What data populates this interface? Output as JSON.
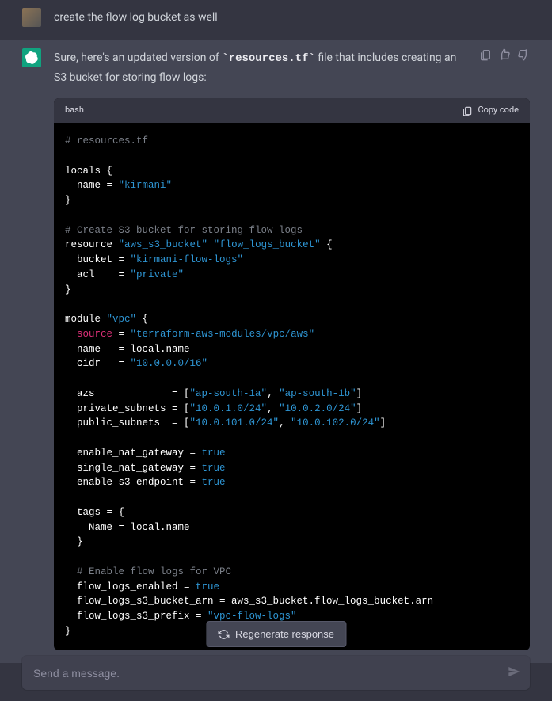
{
  "messages": {
    "user": {
      "text": "create the flow log bucket as well"
    },
    "assistant": {
      "intro_before": "Sure, here's an updated version of ",
      "intro_code": "`resources.tf`",
      "intro_after": " file that includes creating an S3 bucket for storing flow logs:"
    }
  },
  "code": {
    "lang": "bash",
    "copy_label": "Copy code",
    "lines": [
      [
        {
          "t": "comment",
          "v": "# resources.tf"
        }
      ],
      [],
      [
        {
          "t": "default",
          "v": "locals {"
        }
      ],
      [
        {
          "t": "default",
          "v": "  name = "
        },
        {
          "t": "string",
          "v": "\"kirmani\""
        }
      ],
      [
        {
          "t": "default",
          "v": "}"
        }
      ],
      [],
      [
        {
          "t": "comment",
          "v": "# Create S3 bucket for storing flow logs"
        }
      ],
      [
        {
          "t": "default",
          "v": "resource "
        },
        {
          "t": "string",
          "v": "\"aws_s3_bucket\""
        },
        {
          "t": "default",
          "v": " "
        },
        {
          "t": "string",
          "v": "\"flow_logs_bucket\""
        },
        {
          "t": "default",
          "v": " {"
        }
      ],
      [
        {
          "t": "default",
          "v": "  bucket = "
        },
        {
          "t": "string",
          "v": "\"kirmani-flow-logs\""
        }
      ],
      [
        {
          "t": "default",
          "v": "  acl    = "
        },
        {
          "t": "string",
          "v": "\"private\""
        }
      ],
      [
        {
          "t": "default",
          "v": "}"
        }
      ],
      [],
      [
        {
          "t": "default",
          "v": "module "
        },
        {
          "t": "string",
          "v": "\"vpc\""
        },
        {
          "t": "default",
          "v": " {"
        }
      ],
      [
        {
          "t": "default",
          "v": "  "
        },
        {
          "t": "builtin",
          "v": "source"
        },
        {
          "t": "default",
          "v": " = "
        },
        {
          "t": "string",
          "v": "\"terraform-aws-modules/vpc/aws\""
        }
      ],
      [
        {
          "t": "default",
          "v": "  name   = local.name"
        }
      ],
      [
        {
          "t": "default",
          "v": "  cidr   = "
        },
        {
          "t": "string",
          "v": "\"10.0.0.0/16\""
        }
      ],
      [],
      [
        {
          "t": "default",
          "v": "  azs             = ["
        },
        {
          "t": "string",
          "v": "\"ap-south-1a\""
        },
        {
          "t": "default",
          "v": ", "
        },
        {
          "t": "string",
          "v": "\"ap-south-1b\""
        },
        {
          "t": "default",
          "v": "]"
        }
      ],
      [
        {
          "t": "default",
          "v": "  private_subnets = ["
        },
        {
          "t": "string",
          "v": "\"10.0.1.0/24\""
        },
        {
          "t": "default",
          "v": ", "
        },
        {
          "t": "string",
          "v": "\"10.0.2.0/24\""
        },
        {
          "t": "default",
          "v": "]"
        }
      ],
      [
        {
          "t": "default",
          "v": "  public_subnets  = ["
        },
        {
          "t": "string",
          "v": "\"10.0.101.0/24\""
        },
        {
          "t": "default",
          "v": ", "
        },
        {
          "t": "string",
          "v": "\"10.0.102.0/24\""
        },
        {
          "t": "default",
          "v": "]"
        }
      ],
      [],
      [
        {
          "t": "default",
          "v": "  enable_nat_gateway = "
        },
        {
          "t": "literal",
          "v": "true"
        }
      ],
      [
        {
          "t": "default",
          "v": "  single_nat_gateway = "
        },
        {
          "t": "literal",
          "v": "true"
        }
      ],
      [
        {
          "t": "default",
          "v": "  enable_s3_endpoint = "
        },
        {
          "t": "literal",
          "v": "true"
        }
      ],
      [],
      [
        {
          "t": "default",
          "v": "  tags = {"
        }
      ],
      [
        {
          "t": "default",
          "v": "    Name = local.name"
        }
      ],
      [
        {
          "t": "default",
          "v": "  }"
        }
      ],
      [],
      [
        {
          "t": "default",
          "v": "  "
        },
        {
          "t": "comment",
          "v": "# Enable flow logs for VPC"
        }
      ],
      [
        {
          "t": "default",
          "v": "  flow_logs_enabled = "
        },
        {
          "t": "literal",
          "v": "true"
        }
      ],
      [
        {
          "t": "default",
          "v": "  flow_logs_s3_bucket_arn = aws_s3_bucket.flow_logs_bucket.arn"
        }
      ],
      [
        {
          "t": "default",
          "v": "  flow_logs_s3_prefix = "
        },
        {
          "t": "string",
          "v": "\"vpc-flow-logs\""
        }
      ],
      [
        {
          "t": "default",
          "v": "}"
        }
      ]
    ]
  },
  "regen_label": "Regenerate response",
  "input_placeholder": "Send a message."
}
